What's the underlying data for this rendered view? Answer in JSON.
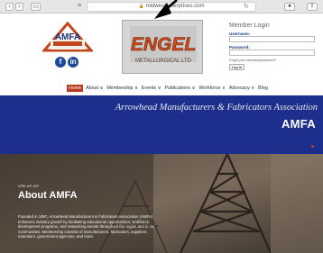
{
  "browser": {
    "url": "midwestenterprises.com",
    "back_icon": "chevron-left-icon",
    "forward_icon": "chevron-right-icon"
  },
  "header": {
    "amfa_logo_text": "AMFA",
    "amfa_logo_subtext": "Arrowhead Manufacturers & Fabricators Association",
    "engel_logo_text": "ENGEL",
    "engel_logo_subtext": "METALLURGICAL LTD"
  },
  "login": {
    "title": "Member Login",
    "username_label": "Username:",
    "password_label": "Password:",
    "forgot_text": "Forgot your username/password?",
    "login_button": "Log In"
  },
  "nav": {
    "items": [
      "Home",
      "About",
      "Membership",
      "Events",
      "Publications",
      "Workforce",
      "Advocacy",
      "Blog"
    ],
    "dropdown_marker": "∨"
  },
  "banner": {
    "tagline": "Arrowhead Manufacturers & Fabricators Association",
    "acronym": "AMFA",
    "color": "#1e2e8c"
  },
  "hero": {
    "eyebrow": "who we are",
    "heading": "About AMFA",
    "paragraph": "Founded in 1997, Arrowhead Manufacturers & Fabricators Association (AMFA) enhances industry growth by facilitating educational opportunities, workforce development programs, and networking events throughout the region and in our communities. Membership consists of manufacturers, fabricators, suppliers, educators, government agencies, and more."
  }
}
